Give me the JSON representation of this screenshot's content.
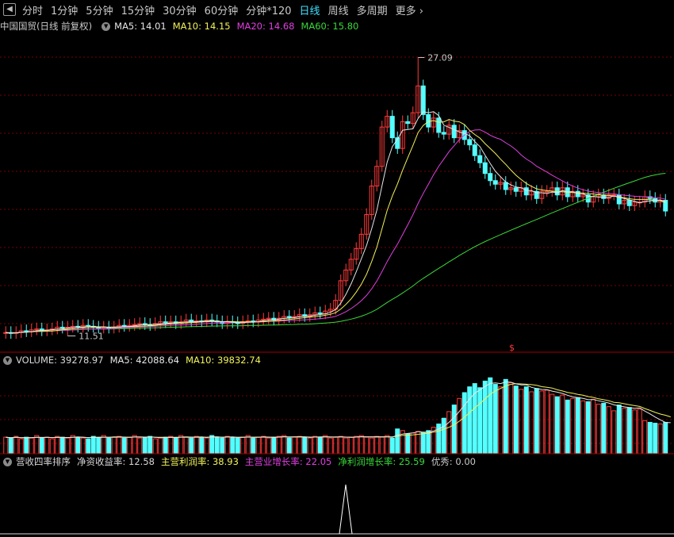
{
  "toolbar": {
    "items": [
      {
        "label": "分时",
        "active": false
      },
      {
        "label": "1分钟",
        "active": false
      },
      {
        "label": "5分钟",
        "active": false
      },
      {
        "label": "15分钟",
        "active": false
      },
      {
        "label": "30分钟",
        "active": false
      },
      {
        "label": "60分钟",
        "active": false
      },
      {
        "label": "分钟*120",
        "active": false
      },
      {
        "label": "日线",
        "active": true
      },
      {
        "label": "周线",
        "active": false
      },
      {
        "label": "多周期",
        "active": false
      },
      {
        "label": "更多",
        "active": false
      }
    ],
    "more_arrow": "›"
  },
  "price_panel": {
    "title": "中国国贸(日线 前复权)",
    "ma": [
      {
        "label": "MA5: 14.01",
        "color": "#e6e6e6"
      },
      {
        "label": "MA10: 14.15",
        "color": "#f2f25a"
      },
      {
        "label": "MA20: 14.68",
        "color": "#e040e0"
      },
      {
        "label": "MA60: 15.80",
        "color": "#39d939"
      }
    ],
    "high_label": "27.09",
    "low_label": "11.51",
    "marker": "$"
  },
  "volume_panel": {
    "label": "VOLUME: 39278.97",
    "ma5": "MA5: 42088.64",
    "ma10": "MA10: 39832.74"
  },
  "indicator_panel": {
    "title": "营收四率排序",
    "fields": [
      {
        "label": "净资收益率: 12.58",
        "color": "#d8d8d8"
      },
      {
        "label": "主营利润率: 38.93",
        "color": "#f2f25a"
      },
      {
        "label": "主营业增长率: 22.05",
        "color": "#e040e0"
      },
      {
        "label": "净利润增长率: 25.59",
        "color": "#39d939"
      },
      {
        "label": "优秀: 0.00",
        "color": "#c8c8c8"
      }
    ]
  },
  "colors": {
    "up": "#ff3b3b",
    "down": "#54ffff",
    "grid": "#7a0000",
    "bg": "#000000"
  },
  "chart_data": {
    "type": "candlestick",
    "high": 27.09,
    "low": 11.51,
    "closes": [
      11.7,
      11.65,
      11.7,
      11.8,
      11.75,
      11.85,
      11.9,
      11.8,
      11.85,
      11.9,
      12.0,
      11.95,
      12.0,
      12.05,
      12.0,
      12.1,
      12.05,
      12.0,
      11.95,
      12.0,
      11.95,
      12.0,
      12.1,
      12.05,
      12.1,
      12.15,
      12.2,
      12.15,
      12.1,
      12.2,
      12.3,
      12.25,
      12.3,
      12.2,
      12.3,
      12.4,
      12.3,
      12.35,
      12.3,
      12.4,
      12.35,
      12.3,
      12.2,
      12.3,
      12.25,
      12.2,
      12.3,
      12.35,
      12.3,
      12.4,
      12.45,
      12.5,
      12.4,
      12.5,
      12.6,
      12.55,
      12.6,
      12.7,
      12.6,
      12.7,
      12.8,
      12.75,
      12.9,
      13.0,
      13.5,
      14.6,
      15.2,
      15.8,
      16.4,
      17.2,
      18.3,
      19.9,
      21.0,
      23.2,
      23.8,
      22.6,
      22.0,
      23.5,
      23.4,
      24.0,
      25.5,
      23.9,
      23.2,
      23.7,
      22.9,
      22.8,
      23.3,
      22.6,
      23.0,
      22.5,
      22.2,
      21.6,
      21.2,
      20.6,
      20.2,
      20.0,
      20.1,
      19.7,
      19.8,
      19.6,
      19.8,
      19.4,
      19.6,
      19.2,
      19.6,
      19.6,
      19.8,
      19.4,
      19.8,
      19.3,
      19.6,
      19.3,
      19.4,
      19.0,
      19.3,
      19.4,
      19.2,
      19.4,
      19.4,
      18.9,
      19.1,
      18.8,
      19.0,
      19.0,
      19.3,
      19.2,
      19.0,
      19.1,
      18.5
    ],
    "volumes": [
      2100,
      2000,
      2200,
      1900,
      2100,
      2000,
      2300,
      2000,
      2100,
      1900,
      2200,
      2100,
      2000,
      2300,
      2100,
      2000,
      1900,
      2200,
      2100,
      2300,
      2000,
      2100,
      2200,
      2000,
      2100,
      2300,
      2000,
      2100,
      2200,
      1900,
      2000,
      2100,
      2200,
      2000,
      2300,
      2100,
      2000,
      2200,
      2100,
      2000,
      2300,
      2100,
      2000,
      2200,
      2100,
      2000,
      2100,
      2300,
      2000,
      2100,
      2200,
      2000,
      2100,
      2200,
      2300,
      2000,
      2100,
      2200,
      2100,
      2000,
      2200,
      2100,
      2300,
      2000,
      2100,
      2200,
      2000,
      2100,
      2200,
      2300,
      2100,
      2000,
      2200,
      2100,
      2300,
      2000,
      3100,
      2900,
      2500,
      2600,
      2800,
      2700,
      2900,
      3300,
      3700,
      4400,
      5200,
      6000,
      6800,
      7500,
      8200,
      8600,
      8100,
      8900,
      9300,
      8500,
      8200,
      9100,
      8700,
      8300,
      7900,
      8200,
      7600,
      8000,
      7700,
      7800,
      7300,
      7000,
      7200,
      6600,
      6800,
      6900,
      6500,
      6400,
      6700,
      6100,
      6200,
      5800,
      5300,
      6000,
      5600,
      5700,
      5400,
      5500,
      4100,
      3900,
      3800,
      3700,
      3900,
      4000
    ]
  }
}
